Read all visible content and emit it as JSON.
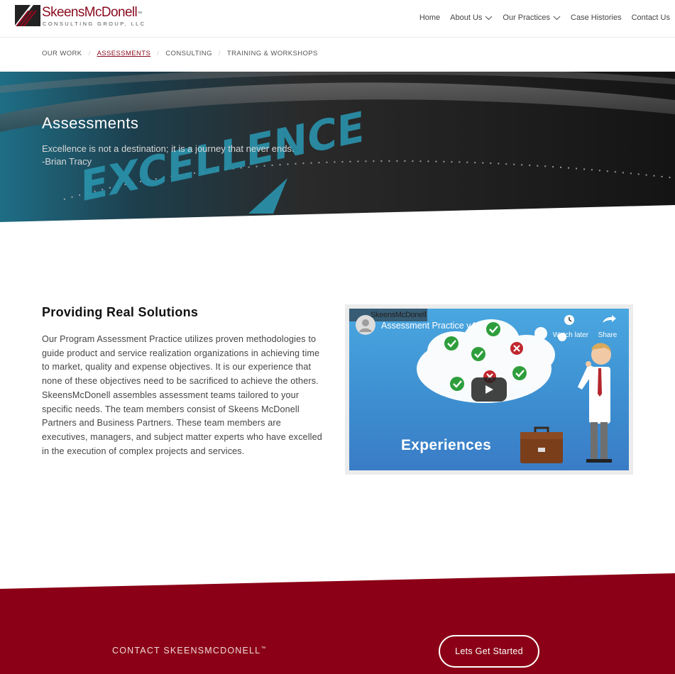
{
  "brand": {
    "name_part1": "Skeens",
    "name_part2": "McDonell",
    "trademark": "™",
    "tagline": "CONSULTING GROUP, LLC"
  },
  "nav": {
    "items": [
      {
        "label": "Home",
        "dropdown": false
      },
      {
        "label": "About Us",
        "dropdown": true
      },
      {
        "label": "Our Practices",
        "dropdown": true
      },
      {
        "label": "Case Histories",
        "dropdown": false
      },
      {
        "label": "Contact Us",
        "dropdown": false
      }
    ]
  },
  "subnav": {
    "items": [
      {
        "label": "OUR WORK",
        "active": false
      },
      {
        "label": "ASSESSMENTS",
        "active": true
      },
      {
        "label": "CONSULTING",
        "active": false
      },
      {
        "label": "TRAINING & WORKSHOPS",
        "active": false
      }
    ],
    "separator": "/"
  },
  "hero": {
    "title": "Assessments",
    "quote_line1": "Excellence is not a destination; it is a journey that never ends.",
    "quote_line2": "-Brian Tracy",
    "image_word": "EXCELLENCE"
  },
  "section": {
    "title": "Providing Real Solutions",
    "body": "Our Program Assessment Practice utilizes proven methodologies to guide product and service realization organizations in achieving time to market, quality and expense objectives. It is our experience that none of these objectives need to be sacrificed to achieve the others. SkeensMcDonell assembles assessment teams tailored to your specific needs. The team members consist of Skeens McDonell Partners and Business Partners. These team members are executives, managers, and subject matter experts who have excelled in the execution of complex projects and services."
  },
  "video": {
    "title": "Assessment Practice v4",
    "channel_logo_text": "SkeensMcDonell",
    "watch_later": "Watch later",
    "share": "Share",
    "caption": "Experiences"
  },
  "footer": {
    "contact_label": "CONTACT SKEENSMCDONELL",
    "trademark": "™",
    "cta": "Lets Get Started"
  },
  "colors": {
    "brand_red": "#8a0b1f",
    "footer_red": "#8b0016",
    "hero_dark": "#1c1c1c",
    "hero_teal": "#1f6f86"
  }
}
